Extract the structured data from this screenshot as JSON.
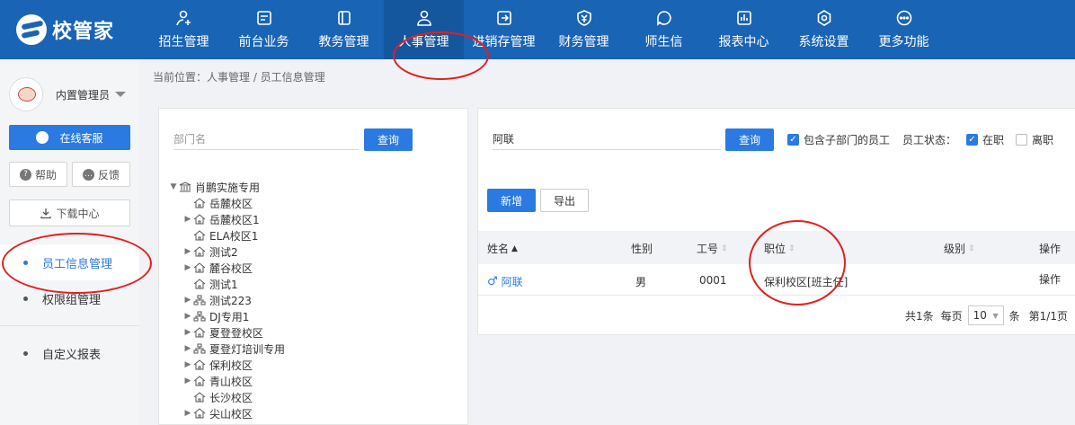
{
  "app": {
    "logo_text": "校管家"
  },
  "nav": [
    {
      "label": "招生管理",
      "icon": "user-plus-icon"
    },
    {
      "label": "前台业务",
      "icon": "monitor-icon"
    },
    {
      "label": "教务管理",
      "icon": "book-icon"
    },
    {
      "label": "人事管理",
      "icon": "person-icon",
      "active": true
    },
    {
      "label": "进销存管理",
      "icon": "inbox-arrow-icon"
    },
    {
      "label": "财务管理",
      "icon": "yen-shield-icon"
    },
    {
      "label": "师生信",
      "icon": "chat-bubble-icon"
    },
    {
      "label": "报表中心",
      "icon": "bar-chart-icon"
    },
    {
      "label": "系统设置",
      "icon": "gear-icon"
    },
    {
      "label": "更多功能",
      "icon": "ellipsis-icon"
    }
  ],
  "sidebar": {
    "user_name": "内置管理员",
    "service_label": "在线客服",
    "help_label": "帮助",
    "feedback_label": "反馈",
    "download_label": "下载中心",
    "menu": [
      {
        "label": "员工信息管理",
        "active": true
      },
      {
        "label": "权限组管理"
      },
      {
        "label": "自定义报表"
      }
    ]
  },
  "breadcrumb": "当前位置：人事管理 / 员工信息管理",
  "dept_panel": {
    "search_placeholder": "部门名",
    "search_button": "查询",
    "tree": [
      {
        "label": "肖鹏实施专用",
        "level": 0,
        "toggle": "expanded",
        "icon": "bank-icon"
      },
      {
        "label": "岳麓校区",
        "level": 1,
        "toggle": "none",
        "icon": "home-icon"
      },
      {
        "label": "岳麓校区1",
        "level": 1,
        "toggle": "collapsed",
        "icon": "home-icon"
      },
      {
        "label": "ELA校区1",
        "level": 1,
        "toggle": "none",
        "icon": "home-icon"
      },
      {
        "label": "测试2",
        "level": 1,
        "toggle": "collapsed",
        "icon": "home-icon"
      },
      {
        "label": "麓谷校区",
        "level": 1,
        "toggle": "collapsed",
        "icon": "home-icon"
      },
      {
        "label": "测试1",
        "level": 1,
        "toggle": "none",
        "icon": "home-icon"
      },
      {
        "label": "测试223",
        "level": 1,
        "toggle": "collapsed",
        "icon": "org-icon"
      },
      {
        "label": "DJ专用1",
        "level": 1,
        "toggle": "collapsed",
        "icon": "org-icon"
      },
      {
        "label": "夏登登校区",
        "level": 1,
        "toggle": "collapsed",
        "icon": "home-icon"
      },
      {
        "label": "夏登灯培训专用",
        "level": 1,
        "toggle": "collapsed",
        "icon": "org-icon"
      },
      {
        "label": "保利校区",
        "level": 1,
        "toggle": "collapsed",
        "icon": "home-icon"
      },
      {
        "label": "青山校区",
        "level": 1,
        "toggle": "collapsed",
        "icon": "home-icon"
      },
      {
        "label": "长沙校区",
        "level": 1,
        "toggle": "none",
        "icon": "home-icon"
      },
      {
        "label": "尖山校区",
        "level": 1,
        "toggle": "collapsed",
        "icon": "home-icon"
      }
    ]
  },
  "staff_panel": {
    "search_value": "阿联",
    "search_button": "查询",
    "include_sub_label": "包含子部门的员工",
    "include_sub_checked": true,
    "status_label": "员工状态：",
    "status_active_label": "在职",
    "status_active_checked": true,
    "status_left_label": "离职",
    "status_left_checked": false,
    "add_button": "新增",
    "export_button": "导出",
    "columns": [
      "姓名",
      "性别",
      "工号",
      "职位",
      "级别",
      "操作"
    ],
    "rows": [
      {
        "name": "阿联",
        "gender": "男",
        "emp_no": "0001",
        "position": "保利校区[班主任]",
        "level": "",
        "action": "操作"
      }
    ],
    "pager": {
      "total_text": "共1条",
      "per_page_label": "每页",
      "per_page_value": "10",
      "unit_label": "条",
      "page_text": "第1/1页"
    }
  },
  "annotation_color": "#e02020"
}
